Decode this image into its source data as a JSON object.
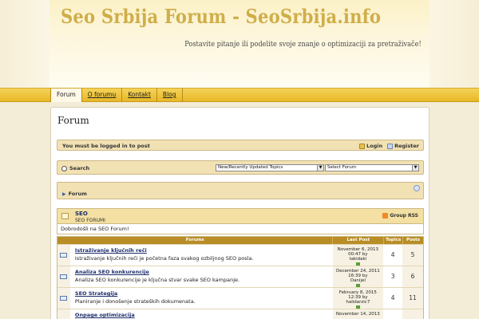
{
  "header": {
    "title": "Seo Srbija Forum - SeoSrbija.info",
    "tagline": "Postavite pitanje ili podelite svoje znanje o optimizaciji za pretraživače!"
  },
  "nav": {
    "items": [
      {
        "label": "Forum"
      },
      {
        "label": "O forumu"
      },
      {
        "label": "Kontakt"
      },
      {
        "label": "Blog"
      }
    ]
  },
  "page": {
    "title": "Forum"
  },
  "login_bar": {
    "message": "You must be logged in to post",
    "login_label": "Login",
    "register_label": "Register"
  },
  "search_bar": {
    "label": "Search",
    "topics_select": "New/Recently Updated Topics",
    "forum_select": "Select Forum"
  },
  "breadcrumb": {
    "label": "Forum"
  },
  "category": {
    "name": "SEO",
    "description": "SEO FORUMI",
    "rss_label": "Group RSS",
    "welcome": "Dobrodošli na SEO Forum!"
  },
  "table": {
    "headers": {
      "forums": "Forums",
      "last_post": "Last Post",
      "topics": "Topics",
      "posts": "Posts"
    },
    "rows": [
      {
        "name": "Istraživanje ključnih reči",
        "desc": "Istraživanje ključnih reči je početna faza svakog ozbiljnog SEO posla.",
        "last_date": "November 6, 2013",
        "last_time": "00:47 by",
        "last_user": "takidaki",
        "topics": "4",
        "posts": "5"
      },
      {
        "name": "Analiza SEO konkurencije",
        "desc": "Analiza SEO konkurencije je ključna stvar svake SEO kampanje.",
        "last_date": "December 24, 2011",
        "last_time": "16:39 by",
        "last_user": "Danijel",
        "topics": "3",
        "posts": "6"
      },
      {
        "name": "SEO Strategija",
        "desc": "Planiranje i donošenje strateških dokumenata.",
        "last_date": "February 8, 2015",
        "last_time": "12:39 by",
        "last_user": "halidarzic7",
        "topics": "4",
        "posts": "11"
      },
      {
        "name": "Onpage optimizacija",
        "desc": "",
        "last_date": "November 14, 2013",
        "last_time": "",
        "last_user": "",
        "topics": "",
        "posts": ""
      }
    ]
  },
  "colors": {
    "accent": "#e8b726",
    "link": "#1d2d6b",
    "table_header": "#b98d26"
  }
}
